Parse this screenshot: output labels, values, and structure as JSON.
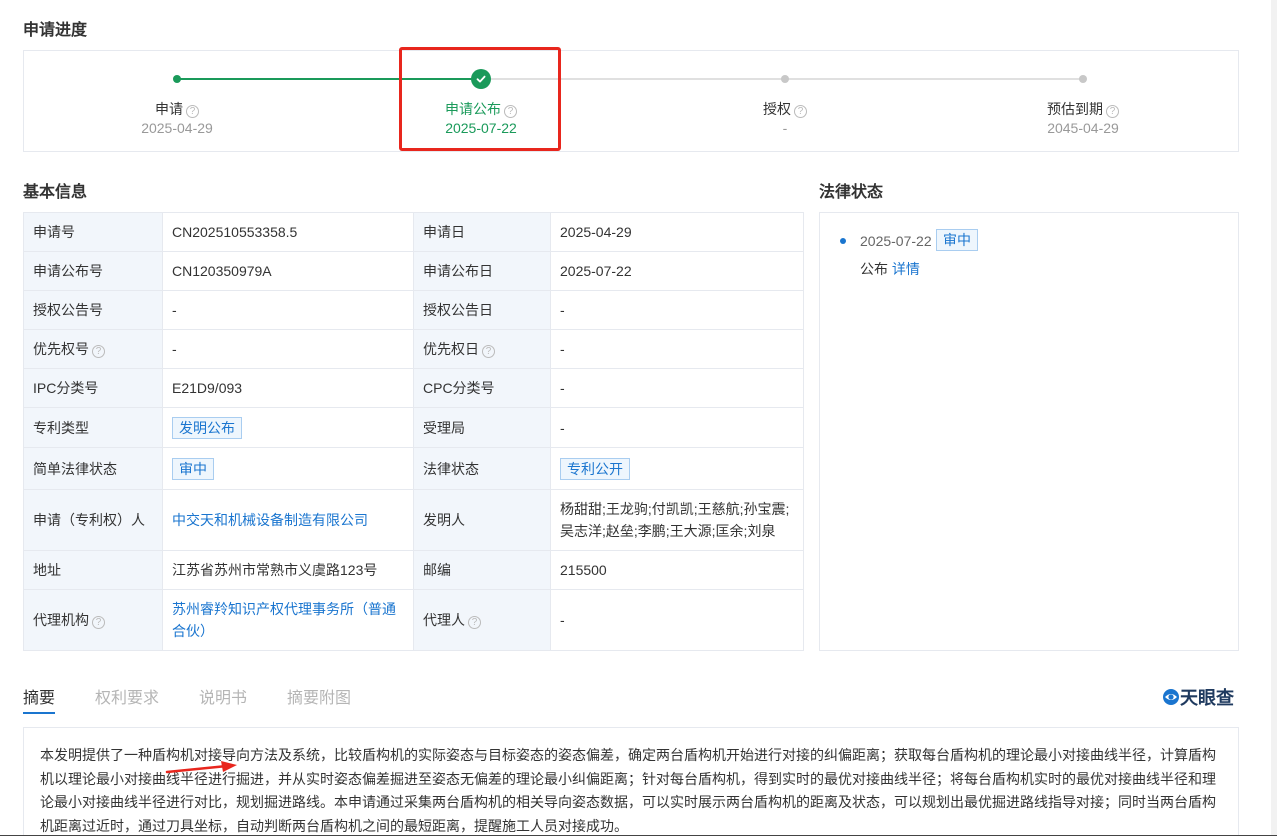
{
  "progress": {
    "title": "申请进度",
    "steps": [
      {
        "label": "申请",
        "date": "2025-04-29"
      },
      {
        "label": "申请公布",
        "date": "2025-07-22"
      },
      {
        "label": "授权",
        "date": "-"
      },
      {
        "label": "预估到期",
        "date": "2045-04-29"
      }
    ],
    "help_glyph": "?",
    "active_step": 1
  },
  "basic_info": {
    "title": "基本信息",
    "rows": [
      {
        "k1": "申请号",
        "v1": "CN202510553358.5",
        "k2": "申请日",
        "v2": "2025-04-29"
      },
      {
        "k1": "申请公布号",
        "v1": "CN120350979A",
        "k2": "申请公布日",
        "v2": "2025-07-22"
      },
      {
        "k1": "授权公告号",
        "v1": "-",
        "k2": "授权公告日",
        "v2": "-"
      },
      {
        "k1": "优先权号",
        "v1": "-",
        "k2": "优先权日",
        "v2": "-"
      },
      {
        "k1": "IPC分类号",
        "v1": "E21D9/093",
        "k2": "CPC分类号",
        "v2": "-"
      },
      {
        "k1": "专利类型",
        "v1": "发明公布",
        "k2": "受理局",
        "v2": "-"
      },
      {
        "k1": "简单法律状态",
        "v1": "审中",
        "k2": "法律状态",
        "v2": "专利公开"
      },
      {
        "k1": "申请（专利权）人",
        "v1": "中交天和机械设备制造有限公司",
        "k2": "发明人",
        "v2": "杨甜甜;王龙驹;付凯凯;王慈航;孙宝震;吴志洋;赵垒;李鹏;王大源;匡余;刘泉"
      },
      {
        "k1": "地址",
        "v1": "江苏省苏州市常熟市义虞路123号",
        "k2": "邮编",
        "v2": "215500"
      },
      {
        "k1": "代理机构",
        "v1": "苏州睿羚知识产权代理事务所（普通合伙）",
        "k2": "代理人",
        "v2": "-"
      }
    ]
  },
  "legal_status": {
    "title": "法律状态",
    "date": "2025-07-22",
    "tag": "审中",
    "event": "公布",
    "detail_link": "详情"
  },
  "tabs": [
    {
      "label": "摘要"
    },
    {
      "label": "权利要求"
    },
    {
      "label": "说明书"
    },
    {
      "label": "摘要附图"
    }
  ],
  "brand": {
    "name": "天眼查"
  },
  "abstract": {
    "text": "本发明提供了一种盾构机对接导向方法及系统，比较盾构机的实际姿态与目标姿态的姿态偏差，确定两台盾构机开始进行对接的纠偏距离；获取每台盾构机的理论最小对接曲线半径，计算盾构机以理论最小对接曲线半径进行掘进，并从实时姿态偏差掘进至姿态无偏差的理论最小纠偏距离；针对每台盾构机，得到实时的最优对接曲线半径；将每台盾构机实时的最优对接曲线半径和理论最小对接曲线半径进行对比，规划掘进路线。本申请通过采集两台盾构机的相关导向姿态数据，可以实时展示两台盾构机的距离及状态，可以规划出最优掘进路线指导对接；同时当两台盾构机距离过近时，通过刀具坐标，自动判断两台盾构机之间的最短距离，提醒施工人员对接成功。"
  },
  "colors": {
    "accent_green": "#1a9a5a",
    "link_blue": "#1a75cf",
    "highlight_red": "#e8261d"
  }
}
